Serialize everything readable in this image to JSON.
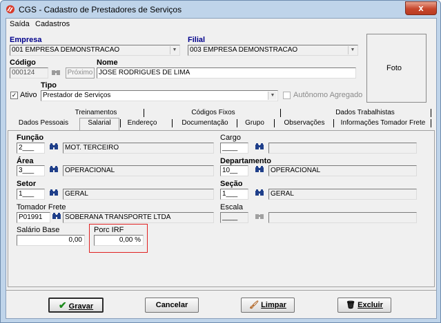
{
  "window": {
    "title": "CGS - Cadastro de Prestadores de Serviços",
    "close_label": "x"
  },
  "menu": {
    "items": [
      "Saída",
      "Cadastros"
    ]
  },
  "header": {
    "empresa_label": "Empresa",
    "empresa_value": "001 EMPRESA DEMONSTRACAO",
    "filial_label": "Filial",
    "filial_value": "003 EMPRESA DEMONSTRACAO",
    "codigo_label": "Código",
    "codigo_value": "000124",
    "proximo_label": "Próximo",
    "nome_label": "Nome",
    "nome_value": "JOSE RODRIGUES  DE LIMA",
    "ativo_label": "Ativo",
    "ativo_checked": true,
    "tipo_label": "Tipo",
    "tipo_value": "Prestador de Serviços",
    "autonomo_label": "Autônomo Agregado",
    "foto_label": "Foto"
  },
  "tabs": {
    "row1": [
      "Treinamentos",
      "Códigos Fixos",
      "Dados Trabalhistas"
    ],
    "row2": [
      "Dados Pessoais",
      "Salarial",
      "Endereço",
      "Documentação",
      "Grupo",
      "Observações",
      "Informações Tomador Frete"
    ],
    "active": "Salarial"
  },
  "salarial": {
    "funcao_label": "Função",
    "funcao_code": "2___",
    "funcao_desc": "MOT. TERCEIRO",
    "cargo_label": "Cargo",
    "cargo_code": "____",
    "cargo_desc": "",
    "area_label": "Área",
    "area_code": "3___",
    "area_desc": "OPERACIONAL",
    "departamento_label": "Departamento",
    "departamento_code": "10__",
    "departamento_desc": "OPERACIONAL",
    "setor_label": "Setor",
    "setor_code": "1___",
    "setor_desc": "GERAL",
    "secao_label": "Seção",
    "secao_code": "1___",
    "secao_desc": "GERAL",
    "tomador_label": "Tomador Frete",
    "tomador_code": "P01991",
    "tomador_desc": "SOBERANA TRANSPORTE LTDA",
    "escala_label": "Escala",
    "escala_code": "____",
    "escala_desc": "",
    "salario_label": "Salário Base",
    "salario_value": "0,00",
    "irrf_label": "Porc IRF",
    "irrf_value": "0,00 %"
  },
  "buttons": {
    "gravar": "Gravar",
    "cancelar": "Cancelar",
    "limpar": "Limpar",
    "excluir": "Excluir"
  }
}
